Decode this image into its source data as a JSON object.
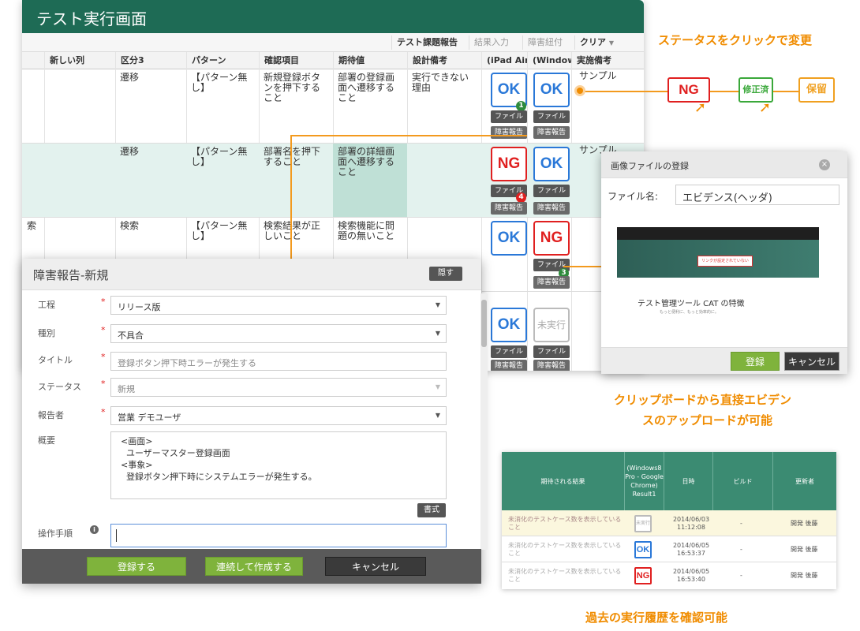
{
  "main": {
    "title": "テスト実行画面",
    "toolbar": {
      "test_report": "テスト課題報告",
      "result_input": "結果入力",
      "bug_link": "障害紐付",
      "clear": "クリア"
    },
    "columns": [
      "新しい列",
      "区分3",
      "パターン",
      "確認項目",
      "期待値",
      "設計備考",
      "(iPad Air",
      "(Window",
      "実施備考"
    ],
    "rows": [
      {
        "category": "遷移",
        "pattern": "【パターン無し】",
        "check": "新規登録ボタンを押下すること",
        "expected": "部署の登録画面へ遷移すること",
        "design_note": "実行できない理由",
        "note": "サンプル",
        "status1": "OK",
        "status2": "OK",
        "badge": "1"
      },
      {
        "category": "遷移",
        "pattern": "【パターン無し】",
        "check": "部署名を押下すること",
        "expected": "部署の詳細画面へ遷移すること",
        "design_note": "",
        "note": "サンプル",
        "status1": "NG",
        "status2": "OK",
        "badge": "4"
      },
      {
        "category": "検索",
        "pattern": "【パターン無し】",
        "check": "検索結果が正しいこと",
        "expected": "検索機能に問題の無いこと",
        "design_note": "",
        "note": "",
        "status1": "OK",
        "status2": "NG",
        "badge": "3"
      },
      {
        "status1": "OK",
        "status2": "未実行"
      }
    ],
    "left_cut": "索",
    "file_label": "ファイル",
    "bug_label": "障害報告"
  },
  "callouts": {
    "status_change": "ステータスをクリックで変更",
    "states": [
      "NG",
      "修正済",
      "保留"
    ],
    "clipboard_line1": "クリップボードから直接エビデン",
    "clipboard_line2": "スのアップロードが可能",
    "history": "過去の実行履歴を確認可能"
  },
  "bug_dialog": {
    "title": "障害報告-新規",
    "hide": "隠す",
    "fields": [
      {
        "label": "工程",
        "value": "リリース版"
      },
      {
        "label": "種別",
        "value": "不具合"
      },
      {
        "label": "タイトル",
        "value": "登録ボタン押下時エラーが発生する"
      },
      {
        "label": "ステータス",
        "value": "新規"
      },
      {
        "label": "報告者",
        "value": "営業 デモユーザ"
      }
    ],
    "summary_label": "概要",
    "summary": "<画面>\n  ユーザーマスター登録画面\n<事象>\n  登録ボタン押下時にシステムエラーが発生する。",
    "format": "書式",
    "steps_label": "操作手順",
    "register": "登録する",
    "register_continue": "連続して作成する",
    "cancel": "キャンセル"
  },
  "image_dialog": {
    "title": "画像ファイルの登録",
    "filename_label": "ファイル名:",
    "filename_value": "エビデンス(ヘッダ)",
    "preview_alert": "リンクが設定されていない",
    "preview_heading": "テスト管理ツール CAT の特徴",
    "preview_sub": "もっと便利に、もっと効率的に。",
    "register": "登録",
    "cancel": "キャンセル"
  },
  "history": {
    "headers": [
      "期待される結果",
      "(Windows8 Pro - Google Chrome) Result1",
      "日時",
      "ビルド",
      "更新者"
    ],
    "rows": [
      {
        "expected": "未消化のテストケース数を表示していること",
        "status": "未実行",
        "date": "2014/06/03",
        "time": "11:12:08",
        "build": "-",
        "user": "開発 後藤"
      },
      {
        "expected": "未消化のテストケース数を表示していること",
        "status": "OK",
        "date": "2014/06/05",
        "time": "16:53:37",
        "build": "-",
        "user": "開発 後藤"
      },
      {
        "expected": "未消化のテストケース数を表示していること",
        "status": "NG",
        "date": "2014/06/05",
        "time": "16:53:40",
        "build": "-",
        "user": "開発 後藤"
      }
    ]
  },
  "colors": {
    "brand": "#1e6b55",
    "ok": "#2a78d8",
    "ng": "#e02020",
    "accent": "#f08c00",
    "fixed": "#3aa83a",
    "hold": "#f0a020"
  }
}
